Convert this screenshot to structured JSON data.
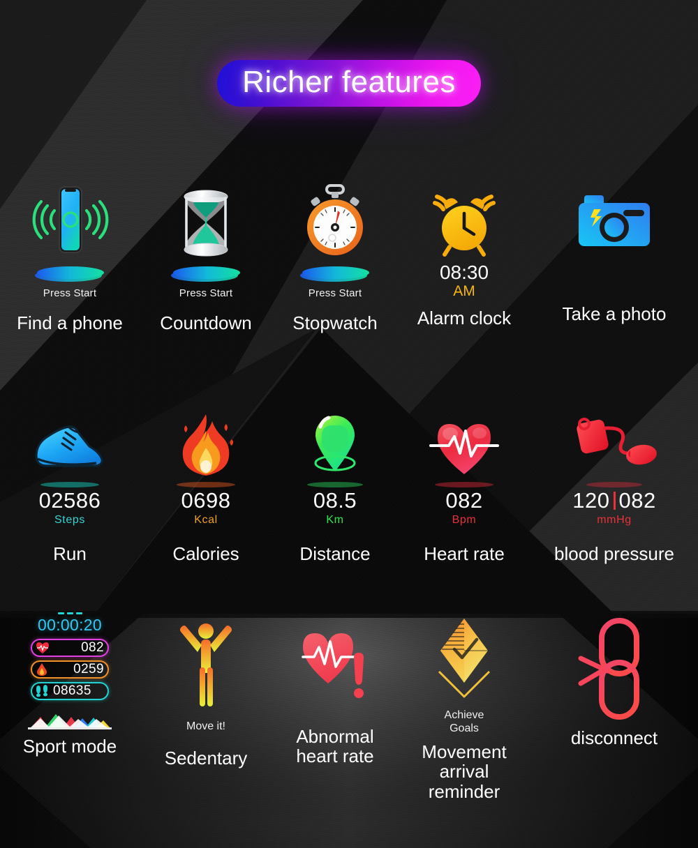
{
  "title": {
    "text": "Richer features"
  },
  "colors": {
    "title_gradient_start": "#1f10d8",
    "title_gradient_end": "#fb1ff5",
    "steps": "#2fd6d6",
    "kcal": "#f0a020",
    "km": "#2ee84a",
    "bpm": "#e8313a",
    "mmhg": "#e8313a",
    "ampm": "#f5b70c",
    "caption": "#ffffff"
  },
  "row1": {
    "items": [
      {
        "caption": "Find a phone",
        "note": "Press Start",
        "icon": "phone-ring-icon"
      },
      {
        "caption": "Countdown",
        "note": "Press Start",
        "icon": "hourglass-icon"
      },
      {
        "caption": "Stopwatch",
        "note": "Press Start",
        "icon": "stopwatch-icon"
      },
      {
        "caption": "Alarm clock",
        "time": "08:30",
        "ampm": "AM",
        "icon": "alarm-clock-icon"
      },
      {
        "caption": "Take a photo",
        "icon": "camera-icon"
      }
    ]
  },
  "row2": {
    "items": [
      {
        "caption": "Run",
        "value": "02586",
        "unit": "Steps",
        "icon": "running-shoe-icon"
      },
      {
        "caption": "Calories",
        "value": "0698",
        "unit": "Kcal",
        "icon": "flame-icon"
      },
      {
        "caption": "Distance",
        "value": "08.5",
        "unit": "Km",
        "icon": "map-pin-icon"
      },
      {
        "caption": "Heart rate",
        "value": "082",
        "unit": "Bpm",
        "icon": "heart-pulse-icon"
      },
      {
        "caption": "blood pressure",
        "value_left": "120",
        "value_right": "082",
        "unit": "mmHg",
        "icon": "blood-pressure-cuff-icon"
      }
    ]
  },
  "row3": {
    "items": [
      {
        "caption": "Sport mode",
        "icon": "sport-watchface-icon"
      },
      {
        "caption": "Sedentary",
        "note": "Move it!",
        "icon": "stretching-person-icon"
      },
      {
        "caption": "Abnormal\nheart rate",
        "icon": "heart-alert-icon"
      },
      {
        "caption": "Movement arrival\nreminder",
        "note": "Achieve\nGoals",
        "icon": "goal-diamond-icon"
      },
      {
        "caption": "disconnect",
        "icon": "broken-chain-icon"
      }
    ]
  },
  "watchface": {
    "dashes": 3,
    "timer": "00:00:20",
    "rows": [
      {
        "icon": "heart-icon",
        "value": "082"
      },
      {
        "icon": "flame-icon",
        "value": "0259"
      },
      {
        "icon": "footsteps-icon",
        "value": "08635"
      }
    ]
  }
}
